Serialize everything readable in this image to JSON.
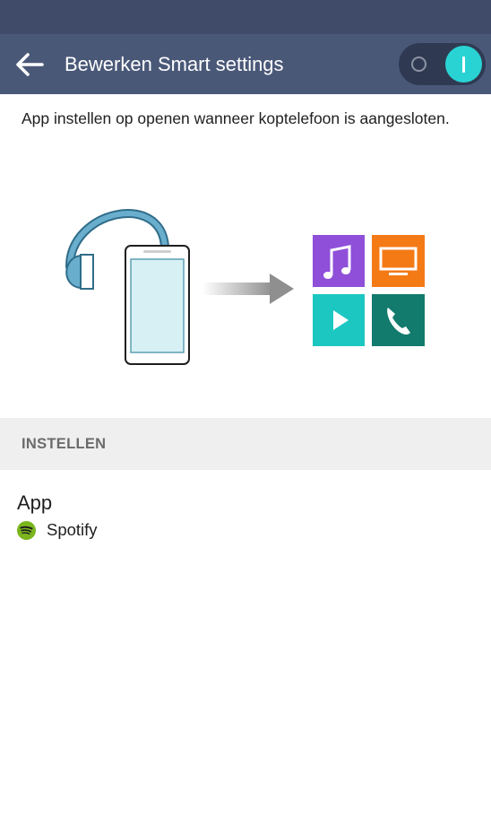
{
  "header": {
    "title": "Bewerken Smart settings",
    "back_icon": "arrow-left-icon",
    "toggle": {
      "state": "on",
      "accent": "#2ad3d3"
    }
  },
  "description": "App instellen op openen wanneer koptelefoon is aangesloten.",
  "illustration": {
    "icons": [
      "headphones-icon",
      "phone-icon",
      "arrow-right-icon",
      "music-app-icon",
      "tv-app-icon",
      "video-app-icon",
      "phone-app-icon"
    ],
    "tile_colors": {
      "music": "#8f4fd9",
      "tv": "#f47a16",
      "video": "#1cc7c1",
      "call": "#127b6d"
    }
  },
  "section": {
    "label": "INSTELLEN"
  },
  "app_setting": {
    "title": "App",
    "value": "Spotify",
    "icon": "spotify-icon",
    "icon_color": "#7ab51d"
  },
  "colors": {
    "status_bar": "#3f4b68",
    "app_bar": "#4a5878"
  }
}
